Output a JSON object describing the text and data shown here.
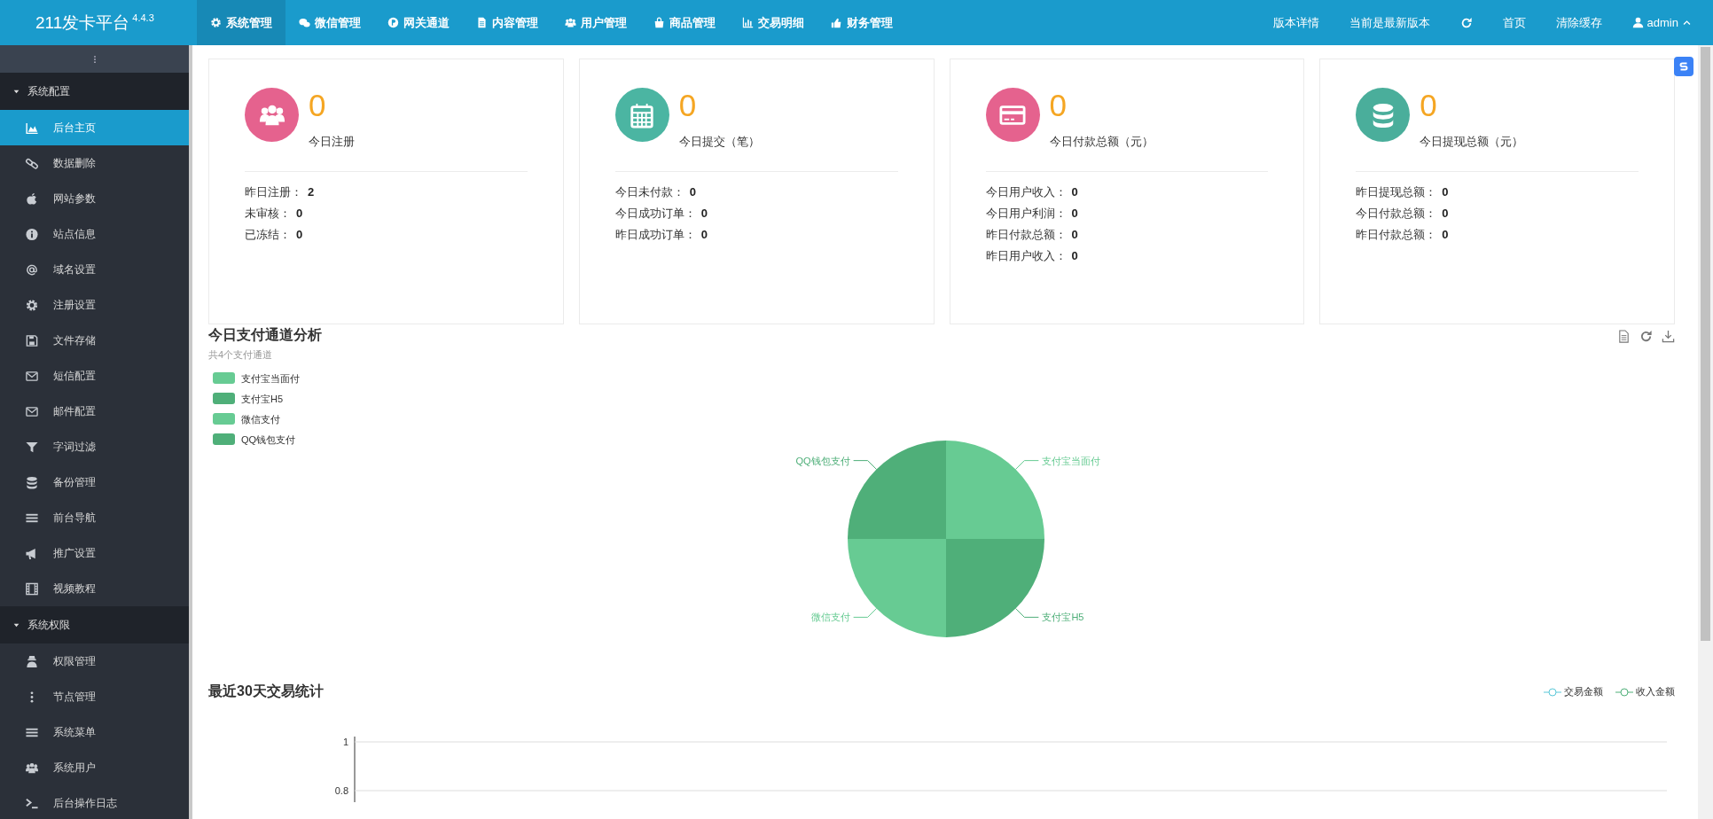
{
  "topbar": {
    "brand": "211发卡平台",
    "version": "4.4.3",
    "nav": [
      {
        "label": "系统管理",
        "selected": true
      },
      {
        "label": "微信管理",
        "selected": false
      },
      {
        "label": "网关通道",
        "selected": false
      },
      {
        "label": "内容管理",
        "selected": false
      },
      {
        "label": "用户管理",
        "selected": false
      },
      {
        "label": "商品管理",
        "selected": false
      },
      {
        "label": "交易明细",
        "selected": false
      },
      {
        "label": "财务管理",
        "selected": false
      }
    ],
    "right": [
      {
        "kind": "link",
        "label": "版本详情"
      },
      {
        "kind": "link",
        "label": "当前是最新版本"
      },
      {
        "kind": "refresh"
      },
      {
        "kind": "link",
        "label": "首页"
      },
      {
        "kind": "link",
        "label": "清除缓存"
      },
      {
        "kind": "user",
        "label": "admin"
      }
    ]
  },
  "sidebar": {
    "groups": [
      {
        "label": "系统配置",
        "expanded": true,
        "items": [
          {
            "label": "后台主页",
            "selected": true
          },
          {
            "label": "数据删除",
            "selected": false
          },
          {
            "label": "网站参数",
            "selected": false
          },
          {
            "label": "站点信息",
            "selected": false
          },
          {
            "label": "域名设置",
            "selected": false
          },
          {
            "label": "注册设置",
            "selected": false
          },
          {
            "label": "文件存储",
            "selected": false
          },
          {
            "label": "短信配置",
            "selected": false
          },
          {
            "label": "邮件配置",
            "selected": false
          },
          {
            "label": "字词过滤",
            "selected": false
          },
          {
            "label": "备份管理",
            "selected": false
          },
          {
            "label": "前台导航",
            "selected": false
          },
          {
            "label": "推广设置",
            "selected": false
          },
          {
            "label": "视频教程",
            "selected": false
          }
        ]
      },
      {
        "label": "系统权限",
        "expanded": true,
        "items": [
          {
            "label": "权限管理",
            "selected": false
          },
          {
            "label": "节点管理",
            "selected": false
          },
          {
            "label": "系统菜单",
            "selected": false
          },
          {
            "label": "系统用户",
            "selected": false
          },
          {
            "label": "后台操作日志",
            "selected": false
          }
        ]
      }
    ]
  },
  "stat_cards": [
    {
      "value": "0",
      "label": "今日注册",
      "color": "#e5628e",
      "details": [
        {
          "label": "昨日注册：",
          "value": "2"
        },
        {
          "label": "未审核：",
          "value": "0"
        },
        {
          "label": "已冻结：",
          "value": "0"
        }
      ]
    },
    {
      "value": "0",
      "label": "今日提交（笔）",
      "color": "#4bb5a2",
      "details": [
        {
          "label": "今日未付款：",
          "value": "0"
        },
        {
          "label": "今日成功订单：",
          "value": "0"
        },
        {
          "label": "昨日成功订单：",
          "value": "0"
        }
      ]
    },
    {
      "value": "0",
      "label": "今日付款总额（元）",
      "color": "#e5628e",
      "details": [
        {
          "label": "今日用户收入：",
          "value": "0"
        },
        {
          "label": "今日用户利润：",
          "value": "0"
        },
        {
          "label": "昨日付款总额：",
          "value": "0"
        },
        {
          "label": "昨日用户收入：",
          "value": "0"
        }
      ]
    },
    {
      "value": "0",
      "label": "今日提现总额（元）",
      "color": "#4aae9b",
      "details": [
        {
          "label": "昨日提现总额：",
          "value": "0"
        },
        {
          "label": "今日付款总额：",
          "value": "0"
        },
        {
          "label": "昨日付款总额：",
          "value": "0"
        }
      ]
    }
  ],
  "pie": {
    "title": "今日支付通道分析",
    "subtitle": "共4个支付通道",
    "chart_data": {
      "type": "pie",
      "categories": [
        "支付宝当面付",
        "支付宝H5",
        "微信支付",
        "QQ钱包支付"
      ],
      "colors": [
        "#67cb93",
        "#4faf79",
        "#67cb93",
        "#4faf79"
      ]
    }
  },
  "line": {
    "title": "最近30天交易统计",
    "chart_data": {
      "type": "line",
      "series": [
        {
          "name": "交易金额",
          "color": "#5bc8d8"
        },
        {
          "name": "收入金额",
          "color": "#4faf79"
        }
      ],
      "ylim": [
        0.8,
        1
      ],
      "yticks": [
        1,
        0.8
      ]
    }
  }
}
